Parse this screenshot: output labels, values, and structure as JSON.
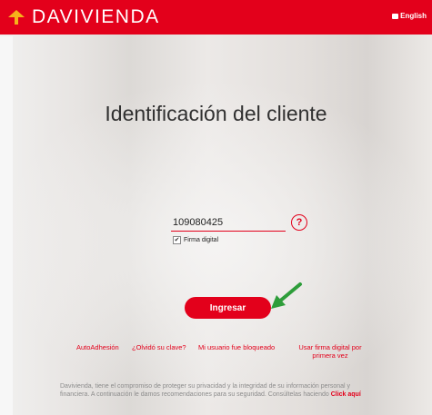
{
  "header": {
    "brand": "DAVIVIENDA",
    "lang_label": "English"
  },
  "page": {
    "title": "Identificación del cliente"
  },
  "login": {
    "user_value": "109080425",
    "help_glyph": "?",
    "firma_label": "Firma digital",
    "firma_checked": true,
    "submit_label": "Ingresar"
  },
  "links": {
    "autoadhesion": "AutoAdhesión",
    "forgot": "¿Olvidó su clave?",
    "blocked": "Mi usuario fue bloqueado",
    "firma_line1": "Usar firma digital por",
    "firma_line2": "primera vez"
  },
  "notice": {
    "text": "Davivienda, tiene el compromiso de proteger su privacidad y la integridad de su información personal y financiera. A continuación le damos recomendaciones para su seguridad. Consúltelas haciendo",
    "link": "Click aquí"
  },
  "colors": {
    "brand_red": "#e3001b",
    "arrow_green": "#2e9d3a"
  },
  "icons": {
    "logo": "house-roof-icon",
    "help": "question-circle-icon",
    "arrow": "arrow-icon",
    "flag": "flag-icon"
  }
}
